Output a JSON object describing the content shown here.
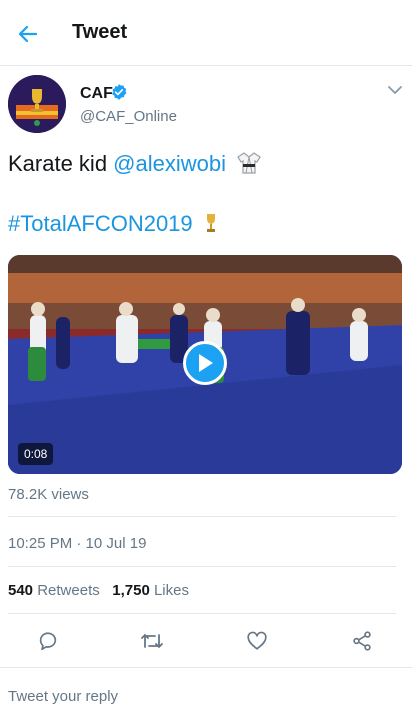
{
  "header": {
    "title": "Tweet",
    "back_icon": "back-arrow-icon"
  },
  "tweet": {
    "author_name": "CAF",
    "author_handle": "@CAF_Online",
    "verified": true,
    "text_prefix": "Karate kid ",
    "mention": "@alexiwobi",
    "hashtag": "#TotalAFCON2019",
    "video_duration": "0:08",
    "views": "78.2K views",
    "timestamp": "10:25 PM · 10 Jul 19",
    "retweets_count": "540",
    "retweets_label": "Retweets",
    "likes_count": "1,750",
    "likes_label": "Likes"
  },
  "actions": [
    "reply-icon",
    "retweet-icon",
    "like-icon",
    "share-icon"
  ],
  "reply": {
    "placeholder": "Tweet your reply"
  },
  "colors": {
    "accent": "#1da1f2",
    "link": "#1b95e0",
    "muted": "#657786",
    "text": "#14171a"
  }
}
